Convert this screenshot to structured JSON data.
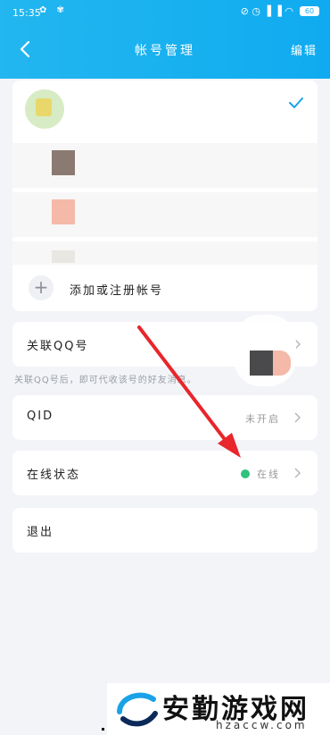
{
  "status_bar": {
    "time": "15:35",
    "left_icons": "✿ ✾",
    "right_icons": "⊘ ◷ ▐ ▐ ◠",
    "battery": "60"
  },
  "nav": {
    "title": "帐号管理",
    "edit_label": "编辑"
  },
  "accounts": {
    "add_label": "添加或注册帐号"
  },
  "linked_qq": {
    "label": "关联QQ号",
    "hint": "关联QQ号后，即可代收该号的好友消息。"
  },
  "qid": {
    "label": "QID",
    "value": "未开启"
  },
  "online_status": {
    "label": "在线状态",
    "value": "在线"
  },
  "logout": {
    "label": "退出"
  },
  "watermark": {
    "title": "安勤游戏网",
    "subtitle": "hzaccw.com"
  },
  "colors": {
    "header": "#17b0ef",
    "online": "#2ec27e",
    "arrow": "#e8262b"
  }
}
